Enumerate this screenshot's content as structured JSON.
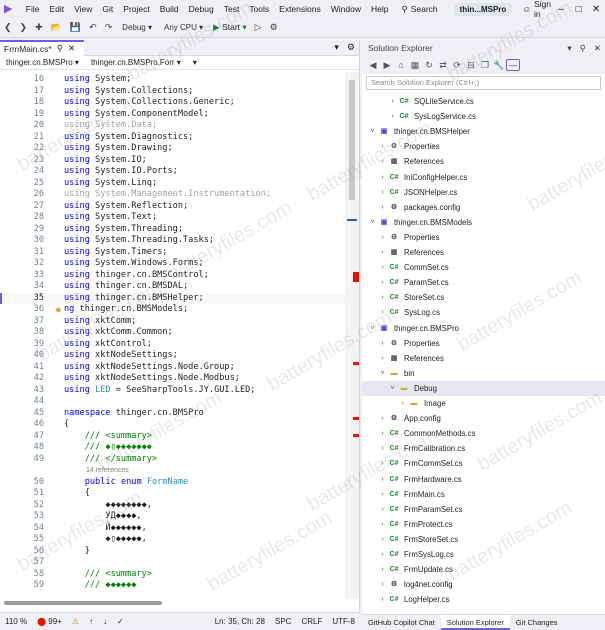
{
  "menu": {
    "items": [
      "File",
      "Edit",
      "View",
      "Git",
      "Project",
      "Build",
      "Debug",
      "Test",
      "Tools",
      "Extensions",
      "Window",
      "Help"
    ],
    "search_label": "Search",
    "window_title": "thin...MSPro",
    "sign_in": "Sign in"
  },
  "toolbar": {
    "config": "Debug",
    "platform": "Any CPU",
    "start_label": "Start"
  },
  "editor": {
    "tab_label": "FrmMain.cs*",
    "nav_project": "thinger.cn.BMSPro",
    "nav_class": "thinger.cn.BMSPro.Forr",
    "lines": [
      {
        "n": "16",
        "t": "using System;"
      },
      {
        "n": "17",
        "t": "using System.Collections;"
      },
      {
        "n": "18",
        "t": "using System.Collections.Generic;"
      },
      {
        "n": "19",
        "t": "using System.ComponentModel;"
      },
      {
        "n": "20",
        "t": "using System.Data;"
      },
      {
        "n": "21",
        "t": "using System.Diagnostics;"
      },
      {
        "n": "22",
        "t": "using System.Drawing;"
      },
      {
        "n": "23",
        "t": "using System.IO;"
      },
      {
        "n": "24",
        "t": "using System.IO.Ports;"
      },
      {
        "n": "25",
        "t": "using System.Linq;"
      },
      {
        "n": "26",
        "t": "using System.Management.Instrumentation;"
      },
      {
        "n": "27",
        "t": "using System.Reflection;"
      },
      {
        "n": "28",
        "t": "using System.Text;"
      },
      {
        "n": "29",
        "t": "using System.Threading;"
      },
      {
        "n": "30",
        "t": "using System.Threading.Tasks;"
      },
      {
        "n": "31",
        "t": "using System.Timers;"
      },
      {
        "n": "32",
        "t": "using System.Windows.Forms;"
      },
      {
        "n": "33",
        "t": "using thinger.cn.BMSControl;"
      },
      {
        "n": "34",
        "t": "using thinger.cn.BMSDAL;"
      },
      {
        "n": "35",
        "t": "using thinger.cn.BMSHelper;"
      },
      {
        "n": "36",
        "t": "ng thinger.cn.BMSModels;"
      },
      {
        "n": "37",
        "t": "using xktComm;"
      },
      {
        "n": "38",
        "t": "using xktComm.Common;"
      },
      {
        "n": "39",
        "t": "using xktControl;"
      },
      {
        "n": "40",
        "t": "using xktNodeSettings;"
      },
      {
        "n": "41",
        "t": "using xktNodeSettings.Node.Group;"
      },
      {
        "n": "42",
        "t": "using xktNodeSettings.Node.Modbus;"
      },
      {
        "n": "43",
        "t": "using LED = SeeSharpTools.JY.GUI.LED;"
      },
      {
        "n": "44",
        "t": ""
      },
      {
        "n": "45",
        "t": "namespace thinger.cn.BMSPro"
      },
      {
        "n": "46",
        "t": "{"
      },
      {
        "n": "47",
        "t": "    /// <summary>"
      },
      {
        "n": "48",
        "t": "    /// ◆▯◆◆◆◆◆◆◆"
      },
      {
        "n": "49",
        "t": "    /// </summary>"
      },
      {
        "n": "",
        "t": "14 references"
      },
      {
        "n": "50",
        "t": "    public enum FormName"
      },
      {
        "n": "51",
        "t": "    {"
      },
      {
        "n": "52",
        "t": "        ◆◆◆◆◆◆◆◆,"
      },
      {
        "n": "53",
        "t": "        УД◆◆◆◆,"
      },
      {
        "n": "54",
        "t": "        Й◆◆◆◆◆◆,"
      },
      {
        "n": "55",
        "t": "        ◆▯◆◆◆◆◆,"
      },
      {
        "n": "56",
        "t": "    }"
      },
      {
        "n": "57",
        "t": ""
      },
      {
        "n": "58",
        "t": "    /// <summary>"
      },
      {
        "n": "59",
        "t": "    /// ◆◆◆◆◆◆"
      }
    ]
  },
  "status": {
    "zoom": "110 %",
    "errors": "99+",
    "position": "Ln: 35, Ch: 28",
    "indent": "SPC",
    "eol": "CRLF",
    "encoding": "UTF-8"
  },
  "solution_explorer": {
    "title": "Solution Explorer",
    "search_placeholder": "Search Solution Explorer (Ctrl+;)",
    "items": [
      {
        "label": "SQLiteService.cs",
        "kind": "cs",
        "depth": 2
      },
      {
        "label": "SysLogService.cs",
        "kind": "cs",
        "depth": 2
      },
      {
        "label": "thinger.cn.BMSHelper",
        "kind": "proj",
        "depth": 0,
        "expanded": true
      },
      {
        "label": "Properties",
        "kind": "prop",
        "depth": 1
      },
      {
        "label": "References",
        "kind": "refs",
        "depth": 1
      },
      {
        "label": "IniConfigHelper.cs",
        "kind": "cs",
        "depth": 1
      },
      {
        "label": "JSONHelper.cs",
        "kind": "cs",
        "depth": 1
      },
      {
        "label": "packages.config",
        "kind": "cfg",
        "depth": 1
      },
      {
        "label": "thinger.cn.BMSModels",
        "kind": "proj",
        "depth": 0,
        "expanded": true
      },
      {
        "label": "Properties",
        "kind": "prop",
        "depth": 1
      },
      {
        "label": "References",
        "kind": "refs",
        "depth": 1
      },
      {
        "label": "CommSet.cs",
        "kind": "cs",
        "depth": 1
      },
      {
        "label": "ParamSet.cs",
        "kind": "cs",
        "depth": 1
      },
      {
        "label": "StoreSet.cs",
        "kind": "cs",
        "depth": 1
      },
      {
        "label": "SysLog.cs",
        "kind": "cs",
        "depth": 1
      },
      {
        "label": "thinger.cn.BMSPro",
        "kind": "proj",
        "depth": 0,
        "expanded": true
      },
      {
        "label": "Properties",
        "kind": "prop",
        "depth": 1
      },
      {
        "label": "References",
        "kind": "refs",
        "depth": 1
      },
      {
        "label": "bin",
        "kind": "folder",
        "depth": 1,
        "expanded": true
      },
      {
        "label": "Debug",
        "kind": "folder",
        "depth": 2,
        "expanded": true,
        "selected": true
      },
      {
        "label": "Image",
        "kind": "folder",
        "depth": 3
      },
      {
        "label": "App.config",
        "kind": "cfg",
        "depth": 1
      },
      {
        "label": "CommonMethods.cs",
        "kind": "cs",
        "depth": 1
      },
      {
        "label": "FrmCalibration.cs",
        "kind": "cs",
        "depth": 1
      },
      {
        "label": "FrmCommSet.cs",
        "kind": "cs",
        "depth": 1
      },
      {
        "label": "FrmHardware.cs",
        "kind": "cs",
        "depth": 1
      },
      {
        "label": "FrmMain.cs",
        "kind": "cs",
        "depth": 1
      },
      {
        "label": "FrmParamSet.cs",
        "kind": "cs",
        "depth": 1
      },
      {
        "label": "FrmProtect.cs",
        "kind": "cs",
        "depth": 1
      },
      {
        "label": "FrmStoreSet.cs",
        "kind": "cs",
        "depth": 1
      },
      {
        "label": "FrmSysLog.cs",
        "kind": "cs",
        "depth": 1
      },
      {
        "label": "FrmUpdate.cs",
        "kind": "cs",
        "depth": 1
      },
      {
        "label": "log4net.config",
        "kind": "cfg",
        "depth": 1
      },
      {
        "label": "LogHelper.cs",
        "kind": "cs",
        "depth": 1
      }
    ],
    "tabs": [
      "GitHub Copilot Chat",
      "Solution Explorer",
      "Git Changes"
    ],
    "active_tab": 1
  },
  "watermark": "batteryfiles.com"
}
